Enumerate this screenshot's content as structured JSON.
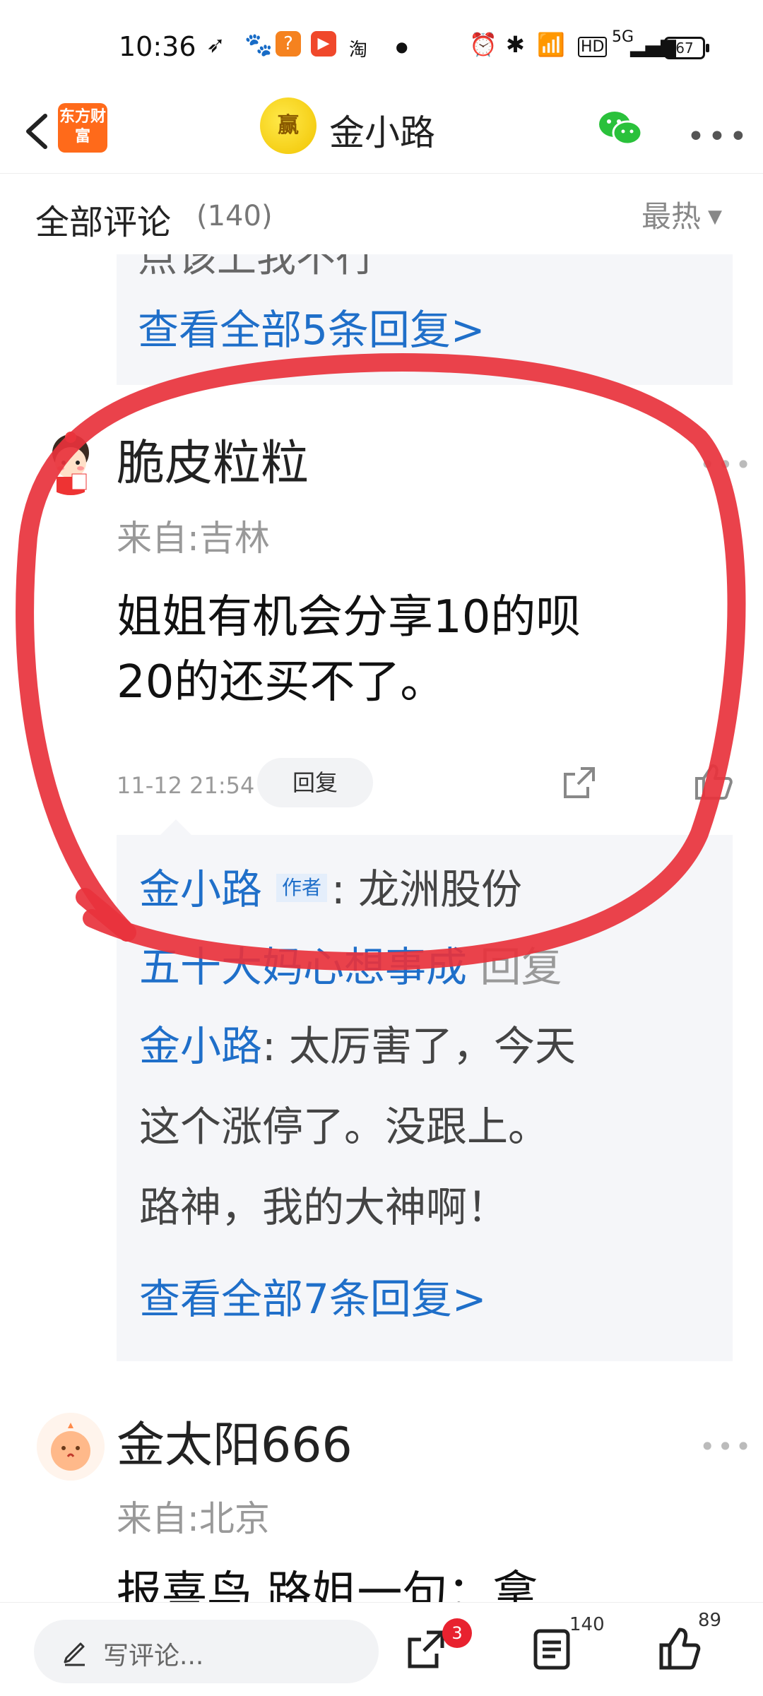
{
  "status_bar": {
    "time": "10:36",
    "net_label": "HD",
    "cell_label": "5G",
    "battery": "67",
    "taobao_icon_text": "淘"
  },
  "nav": {
    "app_logo": "东方财富",
    "avatar_text": "赢",
    "title": "金小路"
  },
  "comments_header": {
    "title": "全部评论",
    "count": "(140)",
    "sort": "最热"
  },
  "reply_box_1": {
    "cut_text": "点该上我不行",
    "view_all": "查看全部5条回复>"
  },
  "comment_1": {
    "name": "脆皮粒粒",
    "from": "来自:吉林",
    "text_line1": "姐姐有机会分享10的呗",
    "text_line2": "20的还买不了。",
    "time": "11-12 21:54",
    "reply_label": "回复",
    "replies": {
      "r1_author": "金小路",
      "r1_badge": "作者",
      "r1_text": ": 龙洲股份",
      "r2_author": "五十大妈心想事成",
      "r2_action": "回复",
      "r2_target": "金小路",
      "r2_text": ": 太厉害了，今天",
      "r2_line2": "这个涨停了。没跟上。",
      "r2_line3": "路神，我的大神啊！",
      "view_all": "查看全部7条回复>"
    }
  },
  "comment_2": {
    "name": "金太阳666",
    "from": "来自:北京",
    "text_cut": "报喜鸟 路姐一句：拿"
  },
  "bottom_bar": {
    "placeholder": "写评论...",
    "share_badge": "3",
    "comment_count": "140",
    "like_count": "89"
  },
  "colors": {
    "link_blue": "#1f6fc9",
    "annotation_red": "#e8323c",
    "badge_red": "#e8222f"
  }
}
